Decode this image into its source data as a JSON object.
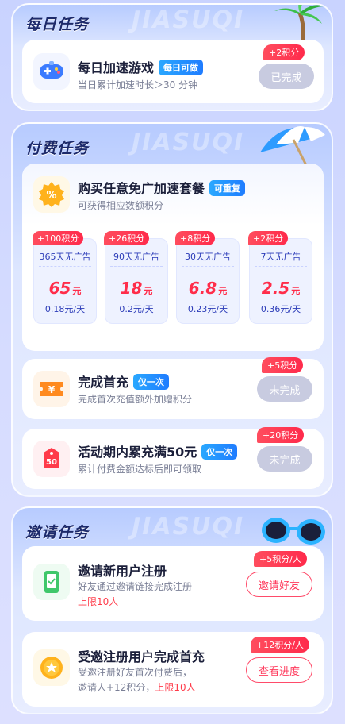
{
  "watermark": "JIASUQI",
  "daily": {
    "title": "每日任务",
    "task": {
      "title": "每日加速游戏",
      "tag": "每日可做",
      "desc": "当日累计加速时长＞30 分钟",
      "reward": "+2积分",
      "button": "已完成"
    }
  },
  "paid": {
    "title": "付费任务",
    "buy": {
      "title": "购买任意免广加速套餐",
      "tag": "可重复",
      "desc": "可获得相应数额积分"
    },
    "packages": [
      {
        "badge": "+100积分",
        "name": "365天无广告",
        "price": "65",
        "unit": "元",
        "per": "0.18元/天"
      },
      {
        "badge": "+26积分",
        "name": "90天无广告",
        "price": "18",
        "unit": "元",
        "per": "0.2元/天"
      },
      {
        "badge": "+8积分",
        "name": "30天无广告",
        "price": "6.8",
        "unit": "元",
        "per": "0.23元/天"
      },
      {
        "badge": "+2积分",
        "name": "7天无广告",
        "price": "2.5",
        "unit": "元",
        "per": "0.36元/天"
      }
    ],
    "first": {
      "title": "完成首充",
      "tag": "仅一次",
      "desc": "完成首次充值额外加赠积分",
      "reward": "+5积分",
      "button": "未完成"
    },
    "accum": {
      "title": "活动期内累充满50元",
      "tag": "仅一次",
      "desc": "累计付费金额达标后即可领取",
      "reward": "+20积分",
      "button": "未完成",
      "icon_text": "50"
    }
  },
  "invite": {
    "title": "邀请任务",
    "register": {
      "title": "邀请新用户注册",
      "desc1": "好友通过邀请链接完成注册",
      "limit": "上限10人",
      "reward": "+5积分/人",
      "button": "邀请好友"
    },
    "firstpay": {
      "title": "受邀注册用户完成首充",
      "desc1": "受邀注册好友首次付费后，",
      "desc2": "邀请人+12积分，",
      "limit": "上限10人",
      "reward": "+12积分/人",
      "button": "查看进度"
    }
  },
  "icon_colors": {
    "accent_blue": "#1f7cff",
    "accent_red": "#ff2a4b",
    "title_navy": "#1d2a6b"
  }
}
